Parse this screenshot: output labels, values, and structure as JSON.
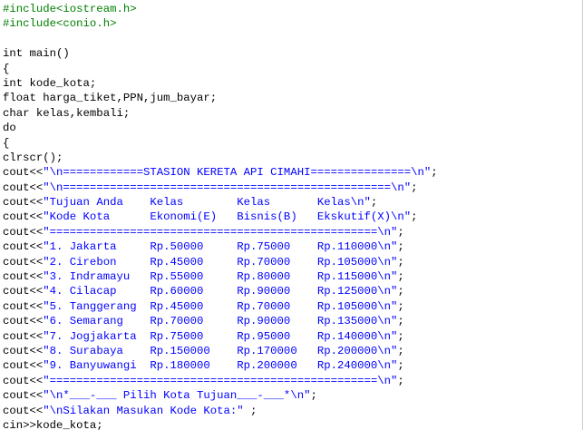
{
  "editor": {
    "colors": {
      "default": "#000000",
      "preprocessor": "#008000",
      "string": "#0000ff",
      "background": "#ffffff"
    },
    "lines": [
      [
        {
          "t": "#include<iostream.h>",
          "k": "pre"
        }
      ],
      [
        {
          "t": "#include<conio.h>",
          "k": "pre"
        }
      ],
      [
        {
          "t": "",
          "k": "plain"
        }
      ],
      [
        {
          "t": "int main()",
          "k": "plain"
        }
      ],
      [
        {
          "t": "{",
          "k": "plain"
        }
      ],
      [
        {
          "t": "int kode_kota;",
          "k": "plain"
        }
      ],
      [
        {
          "t": "float harga_tiket,PPN,jum_bayar;",
          "k": "plain"
        }
      ],
      [
        {
          "t": "char kelas,kembali;",
          "k": "plain"
        }
      ],
      [
        {
          "t": "do",
          "k": "plain"
        }
      ],
      [
        {
          "t": "{",
          "k": "plain"
        }
      ],
      [
        {
          "t": "clrscr();",
          "k": "plain"
        }
      ],
      [
        {
          "t": "cout<<",
          "k": "plain"
        },
        {
          "t": "\"\\n============STASION KERETA API CIMAHI===============\\n\"",
          "k": "str"
        },
        {
          "t": ";",
          "k": "plain"
        }
      ],
      [
        {
          "t": "cout<<",
          "k": "plain"
        },
        {
          "t": "\"\\n=================================================\\n\"",
          "k": "str"
        },
        {
          "t": ";",
          "k": "plain"
        }
      ],
      [
        {
          "t": "cout<<",
          "k": "plain"
        },
        {
          "t": "\"Tujuan Anda    Kelas        Kelas       Kelas\\n\"",
          "k": "str"
        },
        {
          "t": ";",
          "k": "plain"
        }
      ],
      [
        {
          "t": "cout<<",
          "k": "plain"
        },
        {
          "t": "\"Kode Kota      Ekonomi(E)   Bisnis(B)   Ekskutif(X)\\n\"",
          "k": "str"
        },
        {
          "t": ";",
          "k": "plain"
        }
      ],
      [
        {
          "t": "cout<<",
          "k": "plain"
        },
        {
          "t": "\"=================================================\\n\"",
          "k": "str"
        },
        {
          "t": ";",
          "k": "plain"
        }
      ],
      [
        {
          "t": "cout<<",
          "k": "plain"
        },
        {
          "t": "\"1. Jakarta     Rp.50000     Rp.75000    Rp.110000\\n\"",
          "k": "str"
        },
        {
          "t": ";",
          "k": "plain"
        }
      ],
      [
        {
          "t": "cout<<",
          "k": "plain"
        },
        {
          "t": "\"2. Cirebon     Rp.45000     Rp.70000    Rp.105000\\n\"",
          "k": "str"
        },
        {
          "t": ";",
          "k": "plain"
        }
      ],
      [
        {
          "t": "cout<<",
          "k": "plain"
        },
        {
          "t": "\"3. Indramayu   Rp.55000     Rp.80000    Rp.115000\\n\"",
          "k": "str"
        },
        {
          "t": ";",
          "k": "plain"
        }
      ],
      [
        {
          "t": "cout<<",
          "k": "plain"
        },
        {
          "t": "\"4. Cilacap     Rp.60000     Rp.90000    Rp.125000\\n\"",
          "k": "str"
        },
        {
          "t": ";",
          "k": "plain"
        }
      ],
      [
        {
          "t": "cout<<",
          "k": "plain"
        },
        {
          "t": "\"5. Tanggerang  Rp.45000     Rp.70000    Rp.105000\\n\"",
          "k": "str"
        },
        {
          "t": ";",
          "k": "plain"
        }
      ],
      [
        {
          "t": "cout<<",
          "k": "plain"
        },
        {
          "t": "\"6. Semarang    Rp.70000     Rp.90000    Rp.135000\\n\"",
          "k": "str"
        },
        {
          "t": ";",
          "k": "plain"
        }
      ],
      [
        {
          "t": "cout<<",
          "k": "plain"
        },
        {
          "t": "\"7. Jogjakarta  Rp.75000     Rp.95000    Rp.140000\\n\"",
          "k": "str"
        },
        {
          "t": ";",
          "k": "plain"
        }
      ],
      [
        {
          "t": "cout<<",
          "k": "plain"
        },
        {
          "t": "\"8. Surabaya    Rp.150000    Rp.170000   Rp.200000\\n\"",
          "k": "str"
        },
        {
          "t": ";",
          "k": "plain"
        }
      ],
      [
        {
          "t": "cout<<",
          "k": "plain"
        },
        {
          "t": "\"9. Banyuwangi  Rp.180000    Rp.200000   Rp.240000\\n\"",
          "k": "str"
        },
        {
          "t": ";",
          "k": "plain"
        }
      ],
      [
        {
          "t": "cout<<",
          "k": "plain"
        },
        {
          "t": "\"=================================================\\n\"",
          "k": "str"
        },
        {
          "t": ";",
          "k": "plain"
        }
      ],
      [
        {
          "t": "cout<<",
          "k": "plain"
        },
        {
          "t": "\"\\n*___-___ Pilih Kota Tujuan___-___*\\n\"",
          "k": "str"
        },
        {
          "t": ";",
          "k": "plain"
        }
      ],
      [
        {
          "t": "cout<<",
          "k": "plain"
        },
        {
          "t": "\"\\nSilakan Masukan Kode Kota:\" ",
          "k": "str"
        },
        {
          "t": ";",
          "k": "plain"
        }
      ],
      [
        {
          "t": "cin>>kode_kota;",
          "k": "plain"
        }
      ]
    ]
  }
}
